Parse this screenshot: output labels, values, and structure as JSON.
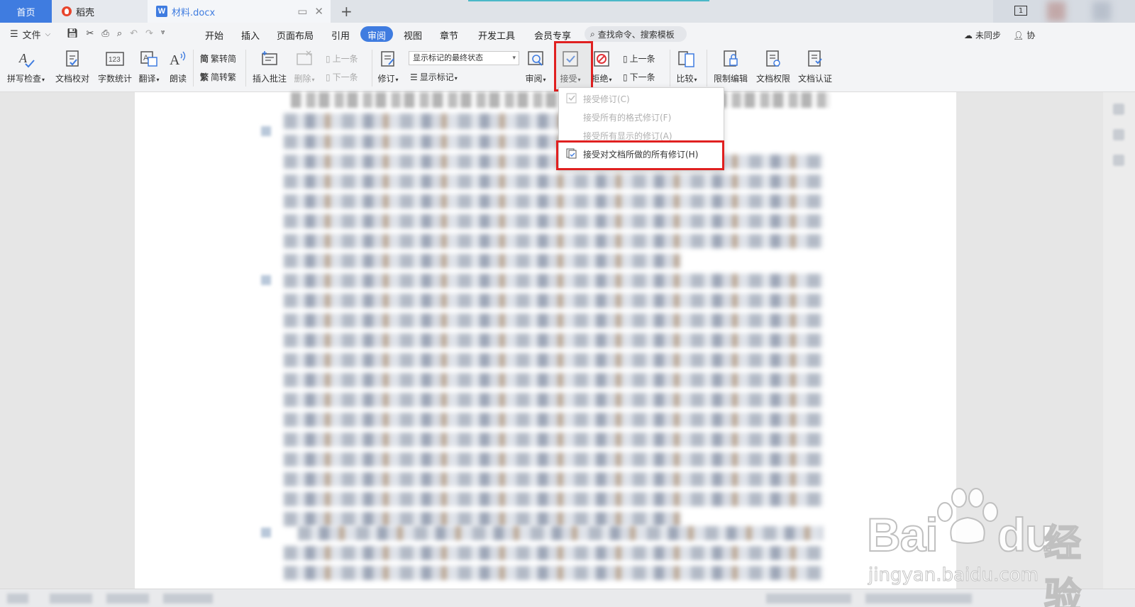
{
  "tabs": {
    "home": "首页",
    "daoke": "稻壳",
    "doc": "材料.docx",
    "add": "+"
  },
  "window": {
    "page_indicator": "1"
  },
  "menu": {
    "file": "文件",
    "items": [
      "开始",
      "插入",
      "页面布局",
      "引用",
      "审阅",
      "视图",
      "章节",
      "开发工具",
      "会员专享"
    ],
    "active": "审阅",
    "search": "查找命令、搜索模板",
    "sync": "未同步",
    "collab": "协"
  },
  "ribbon": {
    "spellcheck": "拼写检查",
    "proofread": "文档校对",
    "wordcount": "字数统计",
    "translate": "翻译",
    "readaloud": "朗读",
    "trad_to_simp": "繁转简",
    "simp_to_trad": "简转繁",
    "insert_comment": "插入批注",
    "delete": "删除",
    "prev_comment": "上一条",
    "next_comment": "下一条",
    "track_changes": "修订",
    "markup_mode": "显示标记的最终状态",
    "show_markup": "显示标记",
    "review_pane": "审阅",
    "accept": "接受",
    "reject": "拒绝",
    "prev_change": "上一条",
    "next_change": "下一条",
    "compare": "比较",
    "restrict_edit": "限制编辑",
    "doc_permission": "文档权限",
    "doc_cert": "文档认证"
  },
  "accept_dropdown": {
    "items": [
      {
        "label": "接受修订(C)",
        "enabled": false
      },
      {
        "label": "接受所有的格式修订(F)",
        "enabled": false
      },
      {
        "label": "接受所有显示的修订(A)",
        "enabled": false
      },
      {
        "label": "接受对文档所做的所有修订(H)",
        "enabled": true
      }
    ]
  },
  "watermark": {
    "brand": "Bai",
    "brand_du": "du",
    "brand_cn": "经验",
    "url": "jingyan.baidu.com"
  },
  "colors": {
    "accent": "#3f7ce0",
    "highlight": "#e02020"
  }
}
